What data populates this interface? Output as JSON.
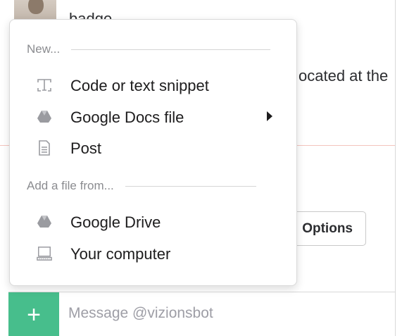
{
  "background": {
    "title_fragment": "badge",
    "body_fragment": "ocated at the",
    "options_button": "Options"
  },
  "message": {
    "plus": "+",
    "placeholder": "Message @vizionsbot"
  },
  "menu": {
    "new_header": "New...",
    "new_items": [
      {
        "label": "Code or text snippet",
        "icon": "snippet-icon"
      },
      {
        "label": "Google Docs file",
        "icon": "google-drive-icon",
        "has_submenu": true
      },
      {
        "label": "Post",
        "icon": "document-icon"
      }
    ],
    "add_header": "Add a file from...",
    "add_items": [
      {
        "label": "Google Drive",
        "icon": "google-drive-icon"
      },
      {
        "label": "Your computer",
        "icon": "computer-icon"
      }
    ]
  },
  "colors": {
    "accent_green": "#2eb67d",
    "icon_gray": "#9a9ba0"
  }
}
